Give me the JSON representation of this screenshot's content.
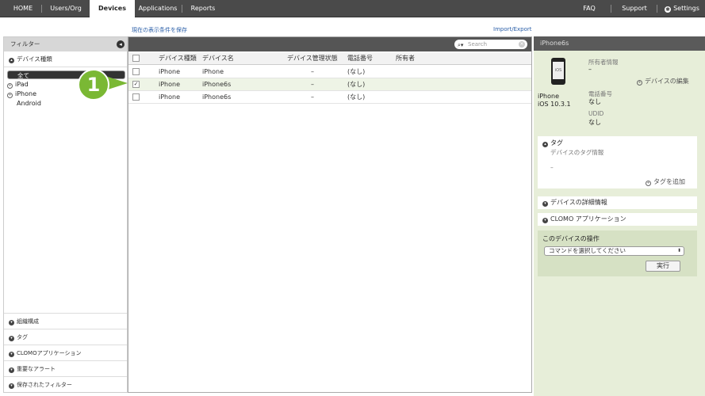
{
  "topnav": {
    "home": "HOME",
    "users_org": "Users/Org",
    "devices": "Devices",
    "applications": "Applications",
    "reports": "Reports",
    "faq": "FAQ",
    "support": "Support",
    "settings": "Settings"
  },
  "links": {
    "save_conditions": "現在の表示条件を保存",
    "import_export": "Import/Export"
  },
  "filter": {
    "title": "フィルター",
    "device_type_section": "デバイス種類",
    "types": [
      "全て",
      "iPad",
      "iPhone",
      "Android"
    ],
    "bottom_sections": [
      "組織構成",
      "タグ",
      "CLOMOアプリケーション",
      "重要なアラート",
      "保存されたフィルター"
    ]
  },
  "grid": {
    "search_placeholder": "Search",
    "headers": [
      "デバイス種類",
      "デバイス名",
      "デバイス管理状態",
      "電話番号",
      "所有者"
    ],
    "rows": [
      {
        "type": "iPhone",
        "name": "iPhone",
        "status": "–",
        "phone": "(なし)",
        "owner": "",
        "checked": false
      },
      {
        "type": "iPhone",
        "name": "iPhone6s",
        "status": "–",
        "phone": "(なし)",
        "owner": "",
        "checked": true
      },
      {
        "type": "iPhone",
        "name": "iPhone6s",
        "status": "–",
        "phone": "(なし)",
        "owner": "",
        "checked": false
      }
    ]
  },
  "callout": "1",
  "detail": {
    "title": "iPhone6s",
    "device_model": "iPhone",
    "os_version": "iOS 10.3.1",
    "screen_label": "iOS",
    "owner_label": "所有者情報",
    "owner_value": "–",
    "edit_link": "デバイスの編集",
    "phone_label": "電話番号",
    "phone_value": "なし",
    "udid_label": "UDID",
    "udid_value": "なし",
    "tag_title": "タグ",
    "tag_info": "デバイスのタグ情報",
    "tag_value": "–",
    "add_tag": "タグを追加",
    "details_section": "デバイスの詳細情報",
    "clomo_apps_section": "CLOMO アプリケーション",
    "ops_title": "このデバイスの操作",
    "command_select": "コマンドを選択してください",
    "run_button": "実行"
  },
  "colors": {
    "nav_bg": "#4a4a4a",
    "accent_green": "#7ab834",
    "detail_bg": "#e7eed9"
  }
}
